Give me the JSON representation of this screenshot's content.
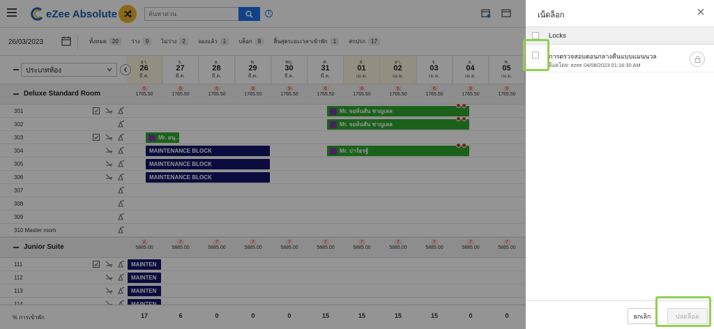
{
  "app": {
    "logo_text": "eZee Absolute"
  },
  "search": {
    "placeholder": "ค้นหาด่วน"
  },
  "filter": {
    "date": "26/03/2023",
    "counts": [
      {
        "label": "ทั้งหมด",
        "value": "20"
      },
      {
        "label": "ว่าง",
        "value": "9"
      },
      {
        "label": "ไม่ว่าง",
        "value": "2"
      },
      {
        "label": "จองแล้ว",
        "value": "1"
      },
      {
        "label": "บล็อก",
        "value": "8"
      },
      {
        "label": "สิ้นสุดระยะเวลาเข้าพัก",
        "value": "1"
      },
      {
        "label": "สกปรก",
        "value": "17"
      }
    ]
  },
  "grid": {
    "roomtype_select": "ประเภทห้อง",
    "days": [
      {
        "name": "อา.",
        "day": "26",
        "month": "มี.ค.",
        "weekend": true
      },
      {
        "name": "จ.",
        "day": "27",
        "month": "มี.ค.",
        "weekend": false
      },
      {
        "name": "อ.",
        "day": "28",
        "month": "มี.ค.",
        "weekend": false
      },
      {
        "name": "พ.",
        "day": "29",
        "month": "มี.ค.",
        "weekend": false
      },
      {
        "name": "พฤ.",
        "day": "30",
        "month": "มี.ค.",
        "weekend": false
      },
      {
        "name": "ศ.",
        "day": "31",
        "month": "มี.ค.",
        "weekend": false
      },
      {
        "name": "ส.",
        "day": "01",
        "month": "เม.ย.",
        "weekend": true
      },
      {
        "name": "อา.",
        "day": "02",
        "month": "เม.ย.",
        "weekend": true
      },
      {
        "name": "จ.",
        "day": "03",
        "month": "เม.ย.",
        "weekend": false
      },
      {
        "name": "อ.",
        "day": "04",
        "month": "เม.ย.",
        "weekend": false
      },
      {
        "name": "พ.",
        "day": "05",
        "month": "เม.ย.",
        "weekend": false
      }
    ],
    "types": [
      {
        "name": "Deluxe Standard Room",
        "avail": [
          "5",
          "6",
          "6",
          "6",
          "9",
          "6",
          "6",
          "6",
          "6",
          "9",
          "9"
        ],
        "rate": "1765.50",
        "rooms": [
          {
            "no": "301",
            "icons": 3
          },
          {
            "no": "302",
            "icons": 1
          },
          {
            "no": "303",
            "icons": 3
          },
          {
            "no": "304",
            "icons": 2
          },
          {
            "no": "305",
            "icons": 2
          },
          {
            "no": "306",
            "icons": 2
          },
          {
            "no": "307",
            "icons": 1
          },
          {
            "no": "308",
            "icons": 1
          },
          {
            "no": "309",
            "icons": 1
          },
          {
            "no": "310 Master room",
            "icons": 1
          }
        ]
      },
      {
        "name": "Junior Suite",
        "avail": [
          "2",
          "7",
          "7",
          "7",
          "7",
          "7",
          "7",
          "7",
          "7",
          "7",
          "7"
        ],
        "rate": "5885.00",
        "rooms": [
          {
            "no": "111",
            "icons": 3
          },
          {
            "no": "112",
            "icons": 2
          },
          {
            "no": "113",
            "icons": 2
          },
          {
            "no": "114",
            "icons": 2
          }
        ]
      }
    ],
    "bookings": [
      {
        "label": "Mr. จอห์นสัน ชาญเลล",
        "row": 0,
        "start": 5.5,
        "len": 4
      },
      {
        "label": "Mr. จอห์นสัน ชาญเลล",
        "row": 1,
        "start": 5.5,
        "len": 4
      },
      {
        "label": "Mr. อนุ...",
        "row": 2,
        "start": 0.5,
        "len": 1
      },
      {
        "label": "Mr. ปาร์ธรฐ์",
        "row": 3,
        "start": 5.5,
        "len": 4
      }
    ],
    "blocks": [
      {
        "label": "MAINTENANCE BLOCK",
        "row": 3,
        "start": 0.5,
        "len": 3.5
      },
      {
        "label": "MAINTENANCE BLOCK",
        "row": 4,
        "start": 0.5,
        "len": 3.5
      },
      {
        "label": "MAINTENANCE BLOCK",
        "row": 5,
        "start": 0.5,
        "len": 3.5
      },
      {
        "label": "MAINTEN",
        "row": 10,
        "start": 0,
        "len": 1
      },
      {
        "label": "MAINTEN",
        "row": 11,
        "start": 0,
        "len": 1
      },
      {
        "label": "MAINTEN",
        "row": 12,
        "start": 0,
        "len": 1
      },
      {
        "label": "MAINTEN",
        "row": 13,
        "start": 0,
        "len": 1
      }
    ],
    "footer": {
      "label": "% การเข้าพัก",
      "values": [
        "17",
        "6",
        "0",
        "0",
        "0",
        "15",
        "15",
        "15",
        "15",
        "0",
        "0"
      ]
    }
  },
  "panel": {
    "title": "เน็ดล็อก",
    "header_label": "Locks",
    "item_name": "การตรวจสอบตอนกลางคืนแบบแมนนวล",
    "item_by": "ล็อคโดย: ezee 04/08/2023 01:16:30 AM",
    "cancel_label": "ยกเลิก",
    "unlock_label": "ปลดล็อค"
  },
  "colors": {
    "booking": "#2fa82f",
    "block": "#14146b",
    "accent": "#1a73e8",
    "highlight": "#8fd14f"
  }
}
